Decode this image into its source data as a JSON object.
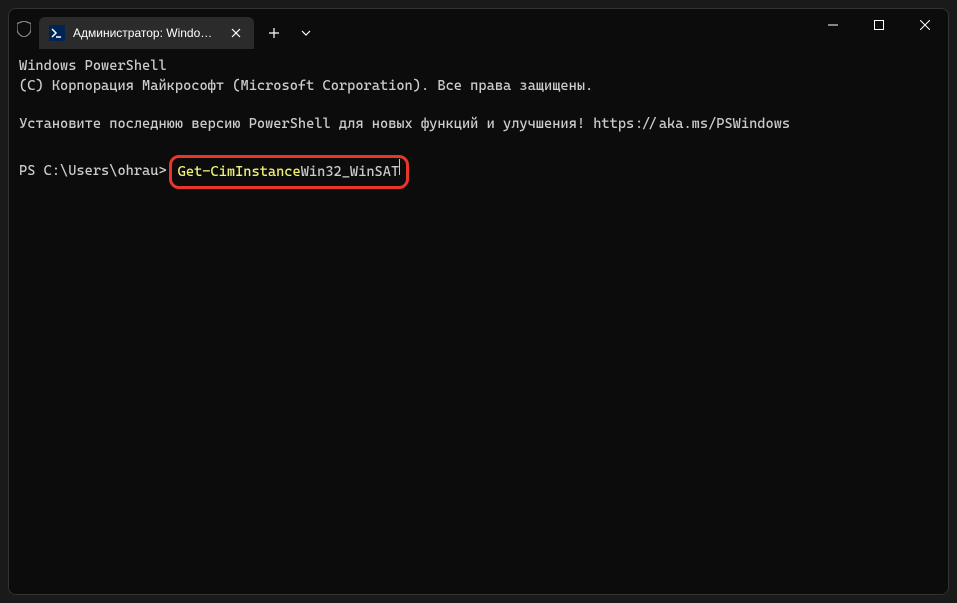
{
  "window": {
    "tab_title": "Администратор: Windows Po",
    "controls": {
      "minimize": "minimize",
      "maximize": "maximize",
      "close": "close"
    }
  },
  "terminal": {
    "line1": "Windows PowerShell",
    "line2": "(C) Корпорация Майкрософт (Microsoft Corporation). Все права защищены.",
    "line3": "Установите последнюю версию PowerShell для новых функций и улучшения! https://aka.ms/PSWindows",
    "prompt": "PS C:\\Users\\ohrau> ",
    "command_cmdlet": "Get-CimInstance",
    "command_arg": " Win32_WinSAT"
  },
  "highlight": {
    "color": "#e8362a"
  }
}
